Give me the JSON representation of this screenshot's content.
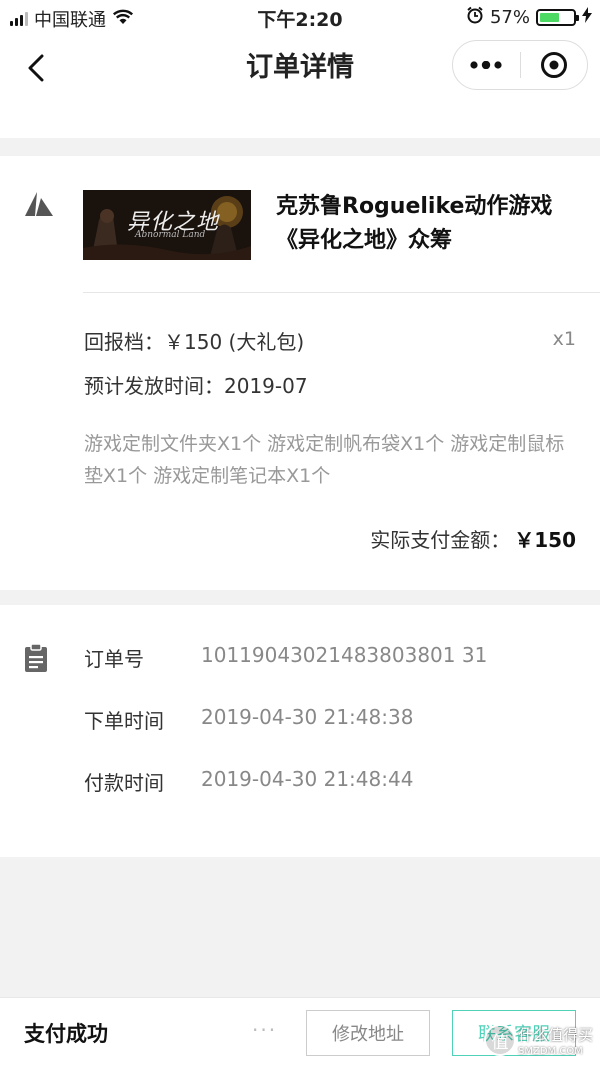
{
  "status_bar": {
    "carrier": "中国联通",
    "time": "下午2:20",
    "battery_percent": "57%",
    "battery_level": 0.57,
    "battery_color": "#4cd964"
  },
  "nav": {
    "title": "订单详情",
    "back_icon": "chevron-left-icon",
    "menu_icon": "more-dots-icon",
    "close_icon": "target-icon"
  },
  "product": {
    "title": "克苏鲁Roguelike动作游戏《异化之地》众筹",
    "thumb_title": "异化之地",
    "thumb_subtitle": "Abnormal Land",
    "tier_label": "回报档：",
    "tier_value": "￥150 (大礼包)",
    "quantity": "x1",
    "ship_label": "预计发放时间：",
    "ship_value": "2019-07",
    "contents": "游戏定制文件夹X1个 游戏定制帆布袋X1个 游戏定制鼠标垫X1个 游戏定制笔记本X1个",
    "paid_label": "实际支付金额：",
    "paid_amount": "￥150"
  },
  "order": {
    "rows": [
      {
        "label": "订单号",
        "value": "10119043021483803801 31"
      },
      {
        "label": "下单时间",
        "value": "2019-04-30  21:48:38"
      },
      {
        "label": "付款时间",
        "value": "2019-04-30  21:48:44"
      }
    ]
  },
  "bottom": {
    "status": "支付成功",
    "more": "···",
    "address_button": "修改地址",
    "support_button": "联系客服",
    "accent_color": "#4fd2b8"
  },
  "watermark": {
    "badge": "值",
    "text": "什么值得买",
    "url": "SMZDM.COM"
  }
}
